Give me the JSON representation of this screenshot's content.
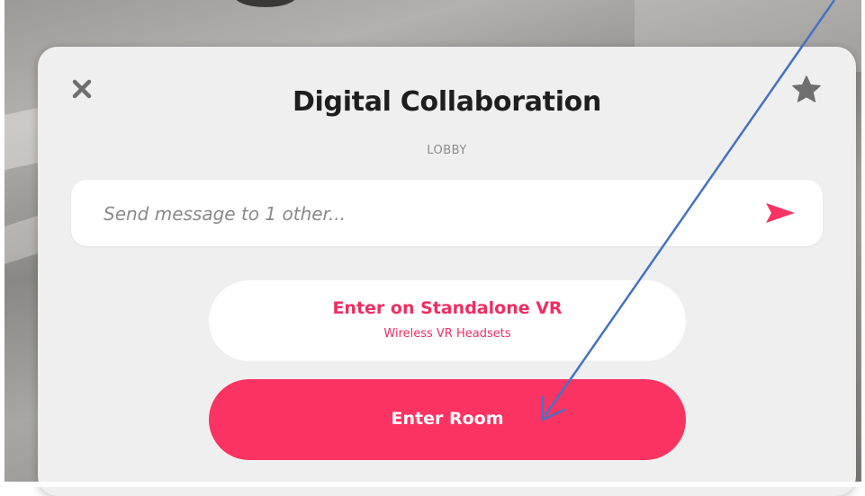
{
  "modal": {
    "title": "Digital Collaboration",
    "subtitle": "LOBBY",
    "close_icon": "close-icon",
    "favorite_icon": "star-icon"
  },
  "message": {
    "placeholder": "Send message to 1 other...",
    "value": "",
    "send_icon": "send-icon"
  },
  "standalone_vr": {
    "label": "Enter on Standalone VR",
    "sublabel": "Wireless VR Headsets"
  },
  "enter_room": {
    "label": "Enter Room"
  },
  "annotation": {
    "arrow_icon": "annotation-arrow",
    "arrow_color": "#4472c4"
  },
  "colors": {
    "accent": "#fb3362",
    "accent_text": "#ef2e62",
    "modal_bg": "#efefef",
    "title_text": "#1e1e1e",
    "icon_gray": "#6f6f6f"
  }
}
